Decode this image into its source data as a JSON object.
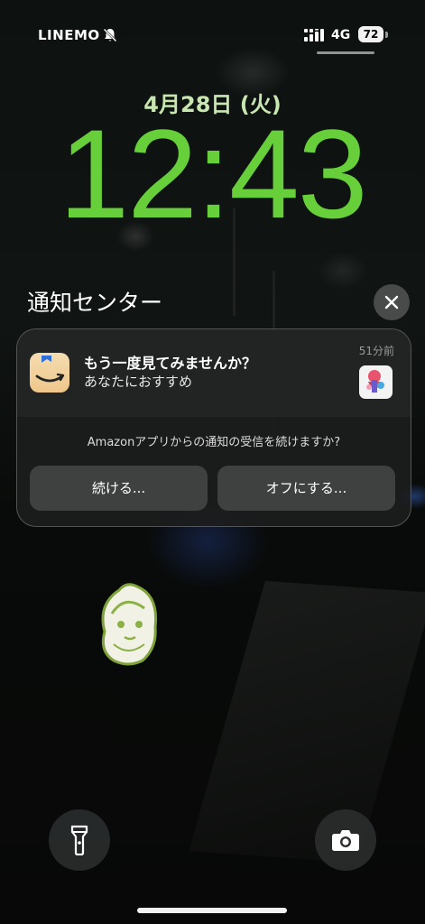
{
  "status_bar": {
    "carrier": "LINEMO",
    "silent_icon": "bell-slash-icon",
    "signal_icon": "signal-bars-icon",
    "network": "4G",
    "battery": "72"
  },
  "lock_screen": {
    "date": "4月28日 (火)",
    "time": "12:43",
    "clock_color": "#66cf3a",
    "date_color": "#c8e6b0"
  },
  "notification_center": {
    "title": "通知センター",
    "clear_icon": "close-icon"
  },
  "notification": {
    "app_icon": "amazon-icon",
    "title": "もう一度見てみませんか？",
    "body": "あなたにおすすめ",
    "time": "51分前",
    "prompt": "Amazonアプリからの通知の受信を続けますか?",
    "continue_label": "続ける...",
    "off_label": "オフにする..."
  },
  "controls": {
    "flashlight_icon": "flashlight-icon",
    "camera_icon": "camera-icon"
  }
}
